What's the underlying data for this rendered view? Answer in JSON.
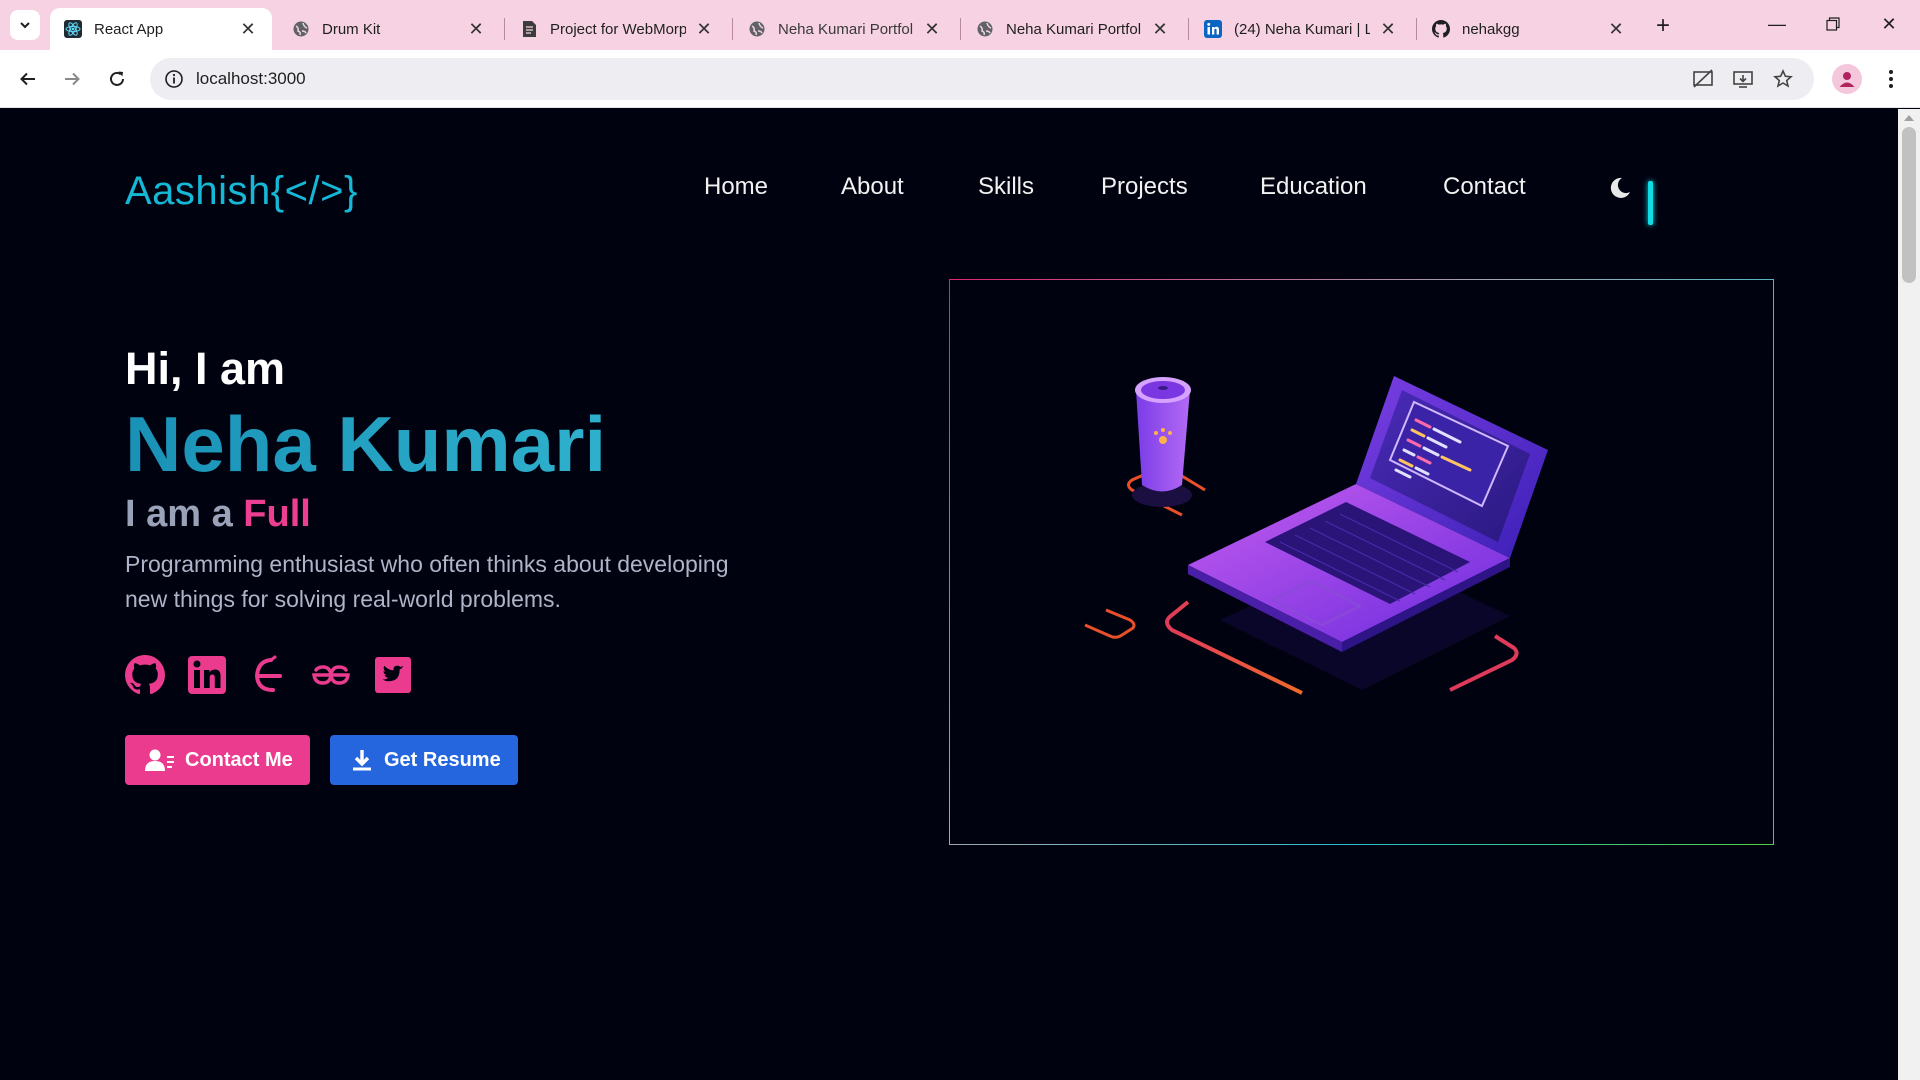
{
  "browser": {
    "tabs": [
      {
        "title": "React App",
        "active": true,
        "icon": "react-icon"
      },
      {
        "title": "Drum Kit",
        "active": false,
        "icon": "globe-icon"
      },
      {
        "title": "Project for WebMorp",
        "active": false,
        "icon": "document-icon"
      },
      {
        "title": "Neha Kumari Portfoli",
        "active": false,
        "icon": "globe-icon"
      },
      {
        "title": "Neha Kumari Portfoli",
        "active": false,
        "icon": "globe-icon"
      },
      {
        "title": "(24) Neha Kumari | Li",
        "active": false,
        "icon": "linkedin-icon"
      },
      {
        "title": "nehakgg",
        "active": false,
        "icon": "github-icon"
      }
    ],
    "url": "localhost:3000"
  },
  "site": {
    "logo": "Aashish{</>}",
    "nav": [
      "Home",
      "About",
      "Skills",
      "Projects",
      "Education",
      "Contact"
    ],
    "theme_toggle_icon": "moon-icon"
  },
  "hero": {
    "greeting": "Hi, I am",
    "name": "Neha Kumari",
    "role_prefix": "I am a",
    "role_highlight": "Full",
    "bio": "Programming enthusiast who often thinks about developing new things for solving real-world problems.",
    "socials": [
      "github-icon",
      "linkedin-icon",
      "codechef-icon",
      "geeksforgeeks-icon",
      "twitter-icon"
    ],
    "contact_button": "Contact Me",
    "resume_button": "Get Resume"
  },
  "colors": {
    "background": "#01020f",
    "accent_cyan": "#15b8d6",
    "accent_pink": "#ea3b8e",
    "button_blue": "#2565dd",
    "tabstrip": "#f6d2e2"
  }
}
